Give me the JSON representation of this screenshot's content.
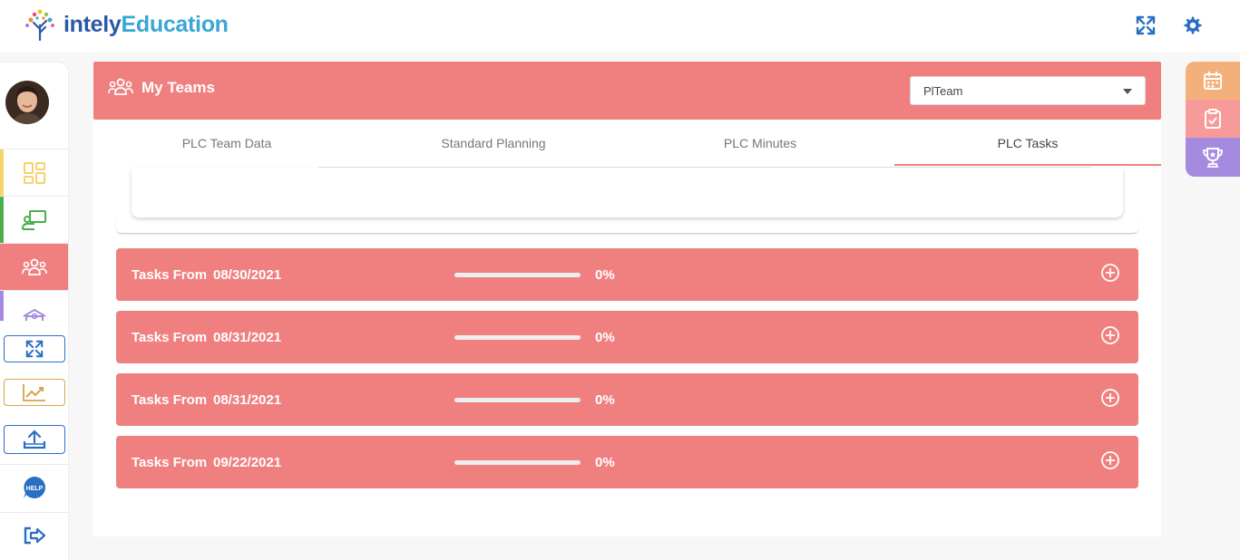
{
  "app": {
    "logo_prefix": "intely",
    "logo_suffix": "Education"
  },
  "header_actions": {
    "fullscreen_icon": "expand-arrows-icon",
    "settings_icon": "gear-icon"
  },
  "sidebar": {
    "items": [
      {
        "name": "dashboard",
        "icon": "grid-icon",
        "color": "#f5d36a"
      },
      {
        "name": "teacher",
        "icon": "teacher-board-icon",
        "color": "#4cae4c"
      },
      {
        "name": "teams",
        "icon": "people-icon",
        "color": "#f08080",
        "active": true
      },
      {
        "name": "school",
        "icon": "school-icon",
        "color": "#a58be0"
      }
    ],
    "buttons": [
      {
        "name": "expand",
        "icon": "expand-arrows-icon",
        "color": "#2a6fc4"
      },
      {
        "name": "analytics",
        "icon": "trend-chart-icon",
        "color": "#d8a24a"
      },
      {
        "name": "upload",
        "icon": "upload-icon",
        "color": "#2a6fc4"
      }
    ],
    "help_label": "HELP",
    "logout_icon": "logout-icon"
  },
  "teams": {
    "title": "My Teams",
    "select_value": "PlTeam"
  },
  "tabs": [
    {
      "label": "PLC Team Data"
    },
    {
      "label": "Standard Planning"
    },
    {
      "label": "PLC Minutes"
    },
    {
      "label": "PLC Tasks",
      "active": true
    }
  ],
  "tasks": [
    {
      "label": "Tasks From",
      "date": "08/30/2021",
      "progress": 0,
      "pct": "0%"
    },
    {
      "label": "Tasks From",
      "date": "08/31/2021",
      "progress": 0,
      "pct": "0%"
    },
    {
      "label": "Tasks From",
      "date": "08/31/2021",
      "progress": 0,
      "pct": "0%"
    },
    {
      "label": "Tasks From",
      "date": "09/22/2021",
      "progress": 0,
      "pct": "0%"
    }
  ],
  "right_panel": [
    {
      "name": "calendar",
      "icon": "calendar-icon",
      "color": "#f4b07a"
    },
    {
      "name": "checklist",
      "icon": "clipboard-check-icon",
      "color": "#f79a9a"
    },
    {
      "name": "trophy",
      "icon": "trophy-icon",
      "color": "#a58be0"
    }
  ],
  "colors": {
    "accent": "#f08080",
    "brand_blue": "#3aa6d6"
  }
}
